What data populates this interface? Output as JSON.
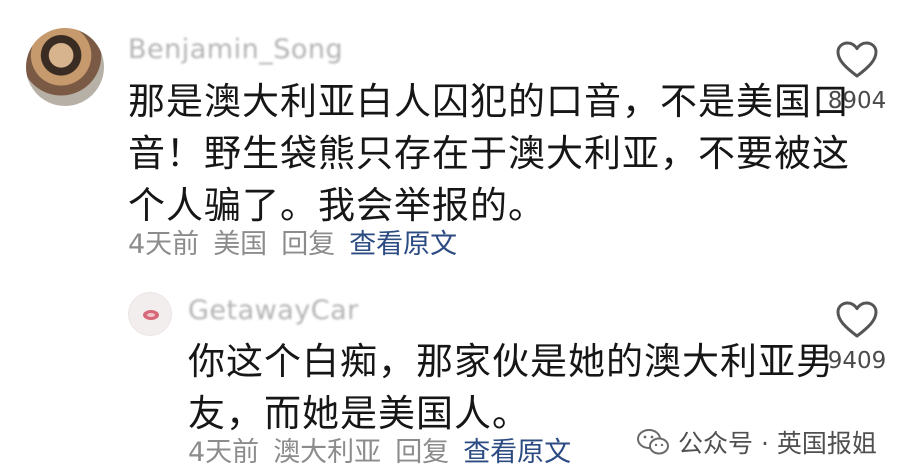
{
  "comments": [
    {
      "username": "Benjamin_Song",
      "text_lines": [
        "那是澳大利亚白人囚犯的口音，不是美国口",
        "音！野生袋熊只存在于澳大利亚，不要被这",
        "个人骗了。我会举报的。"
      ],
      "time": "4天前",
      "location": "美国",
      "reply_label": "回复",
      "view_original_label": "查看原文",
      "likes": "8904"
    },
    {
      "username": "GetawayCar",
      "text_lines": [
        "你这个白痴，那家伙是她的澳大利亚男",
        "友，而她是美国人。"
      ],
      "time": "4天前",
      "location": "澳大利亚",
      "reply_label": "回复",
      "view_original_label": "查看原文",
      "likes": "9409"
    }
  ],
  "watermark": {
    "text": "公众号 · 英国报姐"
  },
  "icons": {
    "like": "heart-outline-icon",
    "watermark": "wechat-icon"
  },
  "colors": {
    "link": "#2b4b82",
    "meta": "#8c8c8c",
    "text": "#161616"
  }
}
